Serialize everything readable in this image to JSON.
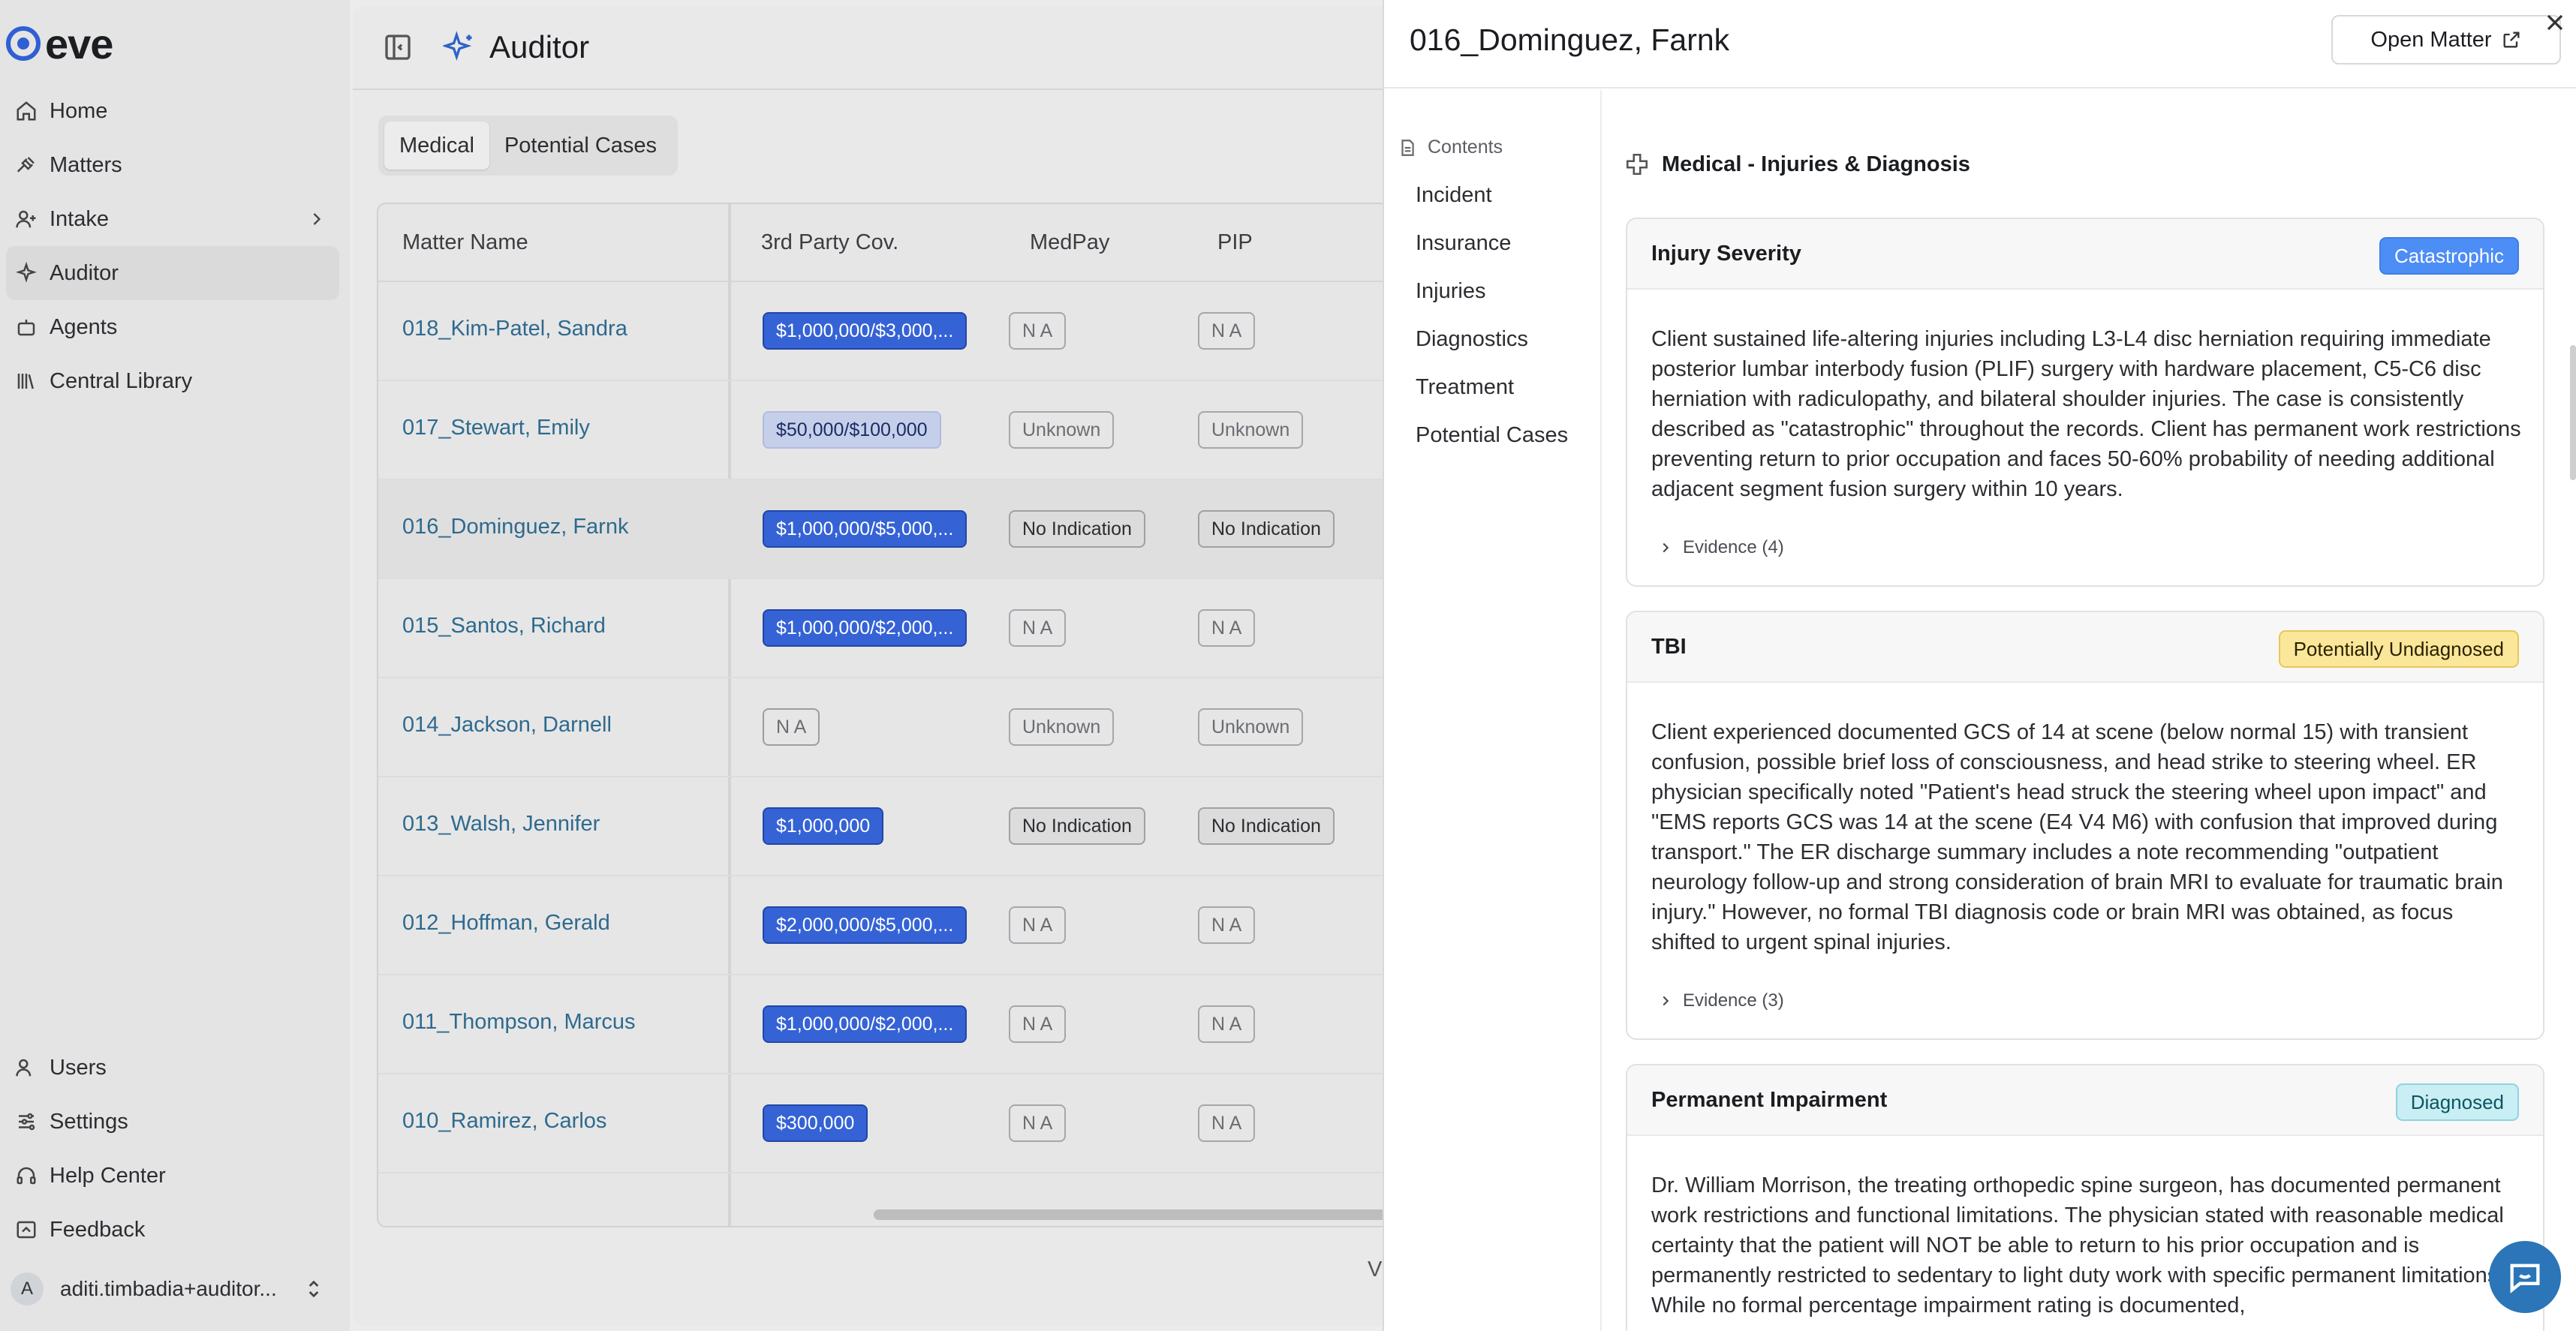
{
  "app": {
    "logo": "eve"
  },
  "sidebar": {
    "items": [
      {
        "label": "Home",
        "icon": "home-icon"
      },
      {
        "label": "Matters",
        "icon": "gavel-icon"
      },
      {
        "label": "Intake",
        "icon": "user-plus-icon"
      },
      {
        "label": "Auditor",
        "icon": "sparkle-icon",
        "active": true
      },
      {
        "label": "Agents",
        "icon": "bot-icon"
      },
      {
        "label": "Central Library",
        "icon": "library-icon"
      }
    ],
    "bottom_items": [
      {
        "label": "Users",
        "icon": "users-icon"
      },
      {
        "label": "Settings",
        "icon": "sliders-icon"
      },
      {
        "label": "Help Center",
        "icon": "help-icon"
      },
      {
        "label": "Feedback",
        "icon": "feedback-icon"
      }
    ],
    "user": {
      "initial": "A",
      "name": "aditi.timbadia+auditor..."
    }
  },
  "main": {
    "title": "Auditor",
    "tabs": [
      "Medical",
      "Potential Cases"
    ],
    "columns": [
      "Matter Name",
      "3rd Party Cov.",
      "MedPay",
      "PIP"
    ],
    "rows": [
      {
        "name": "018_Kim-Patel, Sandra",
        "cov": "$1,000,000/$3,000,...",
        "cov_style": "dark",
        "medpay": "N A",
        "pip": "N A"
      },
      {
        "name": "017_Stewart, Emily",
        "cov": "$50,000/$100,000",
        "cov_style": "light",
        "medpay": "Unknown",
        "pip": "Unknown"
      },
      {
        "name": "016_Dominguez, Farnk",
        "cov": "$1,000,000/$5,000,...",
        "cov_style": "dark",
        "medpay": "No Indication",
        "pip": "No Indication"
      },
      {
        "name": "015_Santos, Richard",
        "cov": "$1,000,000/$2,000,...",
        "cov_style": "dark",
        "medpay": "N A",
        "pip": "N A"
      },
      {
        "name": "014_Jackson, Darnell",
        "cov": "N A",
        "cov_style": "plain",
        "medpay": "Unknown",
        "pip": "Unknown"
      },
      {
        "name": "013_Walsh, Jennifer",
        "cov": "$1,000,000",
        "cov_style": "dark",
        "medpay": "No Indication",
        "pip": "No Indication"
      },
      {
        "name": "012_Hoffman, Gerald",
        "cov": "$2,000,000/$5,000,...",
        "cov_style": "dark",
        "medpay": "N A",
        "pip": "N A"
      },
      {
        "name": "011_Thompson, Marcus",
        "cov": "$1,000,000/$2,000,...",
        "cov_style": "dark",
        "medpay": "N A",
        "pip": "N A"
      },
      {
        "name": "010_Ramirez, Carlos",
        "cov": "$300,000",
        "cov_style": "dark",
        "medpay": "N A",
        "pip": "N A"
      }
    ],
    "pager_text": "V"
  },
  "drawer": {
    "title": "016_Dominguez, Farnk",
    "open_button": "Open Matter",
    "contents_label": "Contents",
    "toc": [
      "Incident",
      "Insurance",
      "Injuries",
      "Diagnostics",
      "Treatment",
      "Potential Cases"
    ],
    "section_title": "Medical - Injuries & Diagnosis",
    "cards": [
      {
        "title": "Injury Severity",
        "status": "Catastrophic",
        "status_color": "#4c8df6",
        "body": "Client sustained life-altering injuries including L3-L4 disc herniation requiring immediate posterior lumbar interbody fusion (PLIF) surgery with hardware placement, C5-C6 disc herniation with radiculopathy, and bilateral shoulder injuries. The case is consistently described as \"catastrophic\" throughout the records. Client has permanent work restrictions preventing return to prior occupation and faces 50-60% probability of needing additional adjacent segment fusion surgery within 10 years.",
        "evidence": "Evidence (4)"
      },
      {
        "title": "TBI",
        "status": "Potentially Undiagnosed",
        "status_color": "#fbe79a",
        "body": "Client experienced documented GCS of 14 at scene (below normal 15) with transient confusion, possible brief loss of consciousness, and head strike to steering wheel. ER physician specifically noted \"Patient's head struck the steering wheel upon impact\" and \"EMS reports GCS was 14 at the scene (E4 V4 M6) with confusion that improved during transport.\" The ER discharge summary includes a note recommending \"outpatient neurology follow-up and strong consideration of brain MRI to evaluate for traumatic brain injury.\" However, no formal TBI diagnosis code or brain MRI was obtained, as focus shifted to urgent spinal injuries.",
        "evidence": "Evidence (3)"
      },
      {
        "title": "Permanent Impairment",
        "status": "Diagnosed",
        "status_color": "#c9eef4",
        "body": "Dr. William Morrison, the treating orthopedic spine surgeon, has documented permanent work restrictions and functional limitations. The physician stated with reasonable medical certainty that the patient will NOT be able to return to his prior occupation and is permanently restricted to sedentary to light duty work with specific permanent limitations. While no formal percentage impairment rating is documented,"
      }
    ]
  }
}
